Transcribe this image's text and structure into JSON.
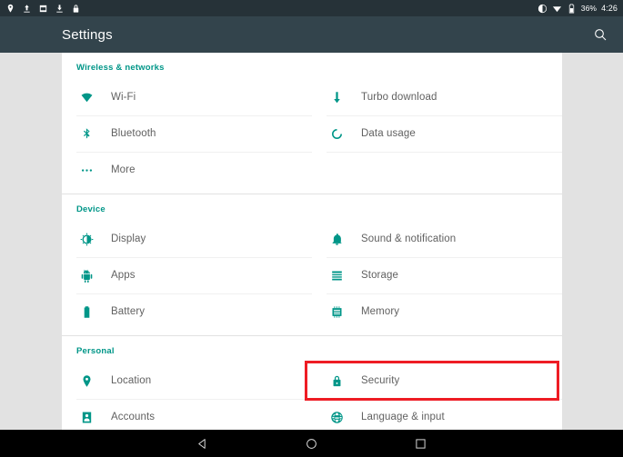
{
  "status_bar": {
    "left_icons": [
      {
        "name": "location-icon"
      },
      {
        "name": "upload-icon"
      },
      {
        "name": "sd-card-icon"
      },
      {
        "name": "download-icon"
      },
      {
        "name": "lock-icon"
      }
    ],
    "right": {
      "brightness_icon": "brightness-icon",
      "wifi_icon": "wifi-icon",
      "battery_icon": "battery-icon",
      "battery_percent": "36%",
      "clock": "4:26"
    }
  },
  "app_bar": {
    "title": "Settings",
    "search_icon": "search-icon"
  },
  "colors": {
    "accent": "#009688",
    "highlight": "#ee1c24",
    "app_bar": "#33444c",
    "status_bar": "#263238",
    "page_bg": "#e2e2e2",
    "label": "#616161"
  },
  "sections": [
    {
      "title": "Wireless & networks",
      "rows": [
        [
          {
            "label": "Wi-Fi",
            "icon": "wifi-icon"
          },
          {
            "label": "Turbo download",
            "icon": "download-arrow-icon"
          }
        ],
        [
          {
            "label": "Bluetooth",
            "icon": "bluetooth-icon"
          },
          {
            "label": "Data usage",
            "icon": "data-usage-icon"
          }
        ],
        [
          {
            "label": "More",
            "icon": "more-dots-icon"
          },
          {
            "label": "",
            "icon": ""
          }
        ]
      ]
    },
    {
      "title": "Device",
      "rows": [
        [
          {
            "label": "Display",
            "icon": "brightness-icon"
          },
          {
            "label": "Sound & notification",
            "icon": "bell-icon"
          }
        ],
        [
          {
            "label": "Apps",
            "icon": "android-icon"
          },
          {
            "label": "Storage",
            "icon": "storage-icon"
          }
        ],
        [
          {
            "label": "Battery",
            "icon": "battery-icon"
          },
          {
            "label": "Memory",
            "icon": "memory-icon"
          }
        ]
      ]
    },
    {
      "title": "Personal",
      "rows": [
        [
          {
            "label": "Location",
            "icon": "location-pin-icon"
          },
          {
            "label": "Security",
            "icon": "lock-icon"
          }
        ],
        [
          {
            "label": "Accounts",
            "icon": "accounts-icon"
          },
          {
            "label": "Language & input",
            "icon": "globe-icon"
          }
        ]
      ]
    }
  ],
  "highlighted_item": "Security",
  "nav_bar": {
    "back": "back-triangle-icon",
    "home": "home-circle-icon",
    "recents": "recents-square-icon"
  }
}
